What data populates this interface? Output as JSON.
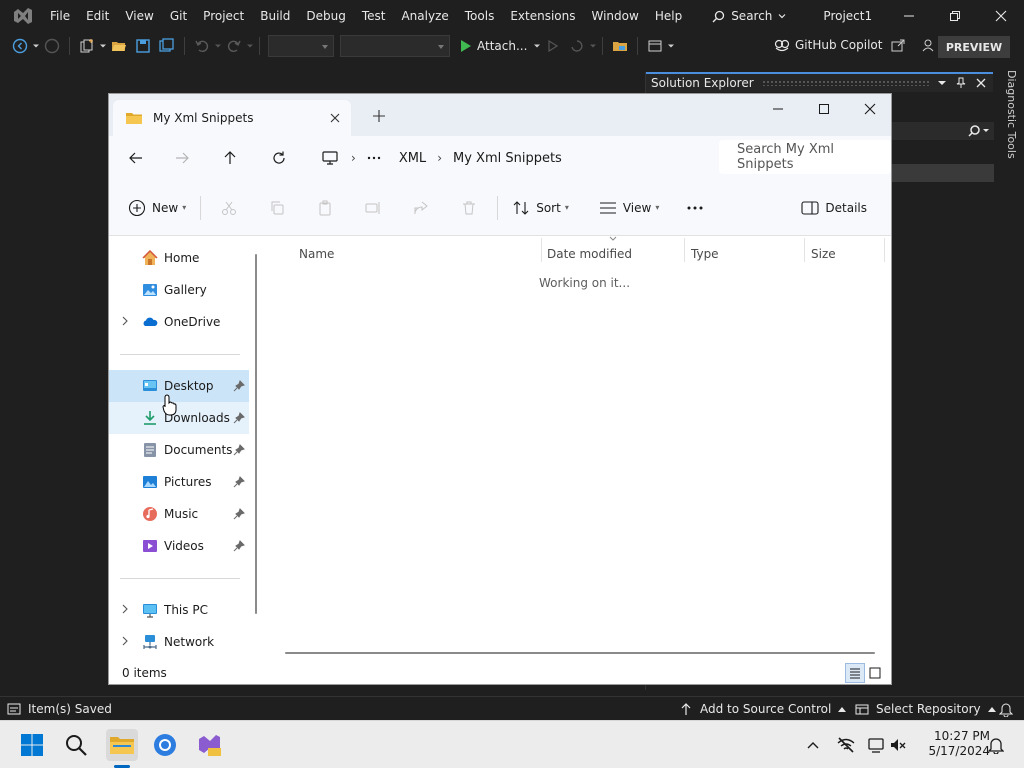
{
  "vs": {
    "menu": [
      "File",
      "Edit",
      "View",
      "Git",
      "Project",
      "Build",
      "Debug",
      "Test",
      "Analyze",
      "Tools",
      "Extensions",
      "Window",
      "Help"
    ],
    "search_label": "Search",
    "project_title": "Project1",
    "attach_label": "Attach...",
    "copilot_label": "GitHub Copilot",
    "preview_label": "PREVIEW",
    "solution_explorer_title": "Solution Explorer",
    "diagnostic_tools_label": "Diagnostic Tools",
    "status": {
      "message": "Item(s) Saved",
      "source_control": "Add to Source Control",
      "repository": "Select Repository"
    }
  },
  "explorer": {
    "tab_title": "My Xml Snippets",
    "breadcrumb": [
      "XML",
      "My Xml Snippets"
    ],
    "search_placeholder": "Search My Xml Snippets",
    "commands": {
      "new": "New",
      "sort": "Sort",
      "view": "View",
      "details": "Details"
    },
    "sidebar": [
      {
        "label": "Home",
        "icon": "home-icon"
      },
      {
        "label": "Gallery",
        "icon": "gallery-icon"
      },
      {
        "label": "OneDrive",
        "icon": "onedrive-icon"
      },
      {
        "label": "Desktop",
        "icon": "desktop-icon"
      },
      {
        "label": "Downloads",
        "icon": "downloads-icon"
      },
      {
        "label": "Documents",
        "icon": "documents-icon"
      },
      {
        "label": "Pictures",
        "icon": "pictures-icon"
      },
      {
        "label": "Music",
        "icon": "music-icon"
      },
      {
        "label": "Videos",
        "icon": "videos-icon"
      },
      {
        "label": "This PC",
        "icon": "this-pc-icon"
      },
      {
        "label": "Network",
        "icon": "network-icon"
      }
    ],
    "columns": [
      "Name",
      "Date modified",
      "Type",
      "Size"
    ],
    "loading_text": "Working on it...",
    "item_count": "0 items"
  },
  "taskbar": {
    "time": "10:27 PM",
    "date": "5/17/2024"
  },
  "colors": {
    "accent": "#0067c0",
    "vs_background": "#1f1f1f",
    "explorer_selection": "#cce4f7"
  }
}
